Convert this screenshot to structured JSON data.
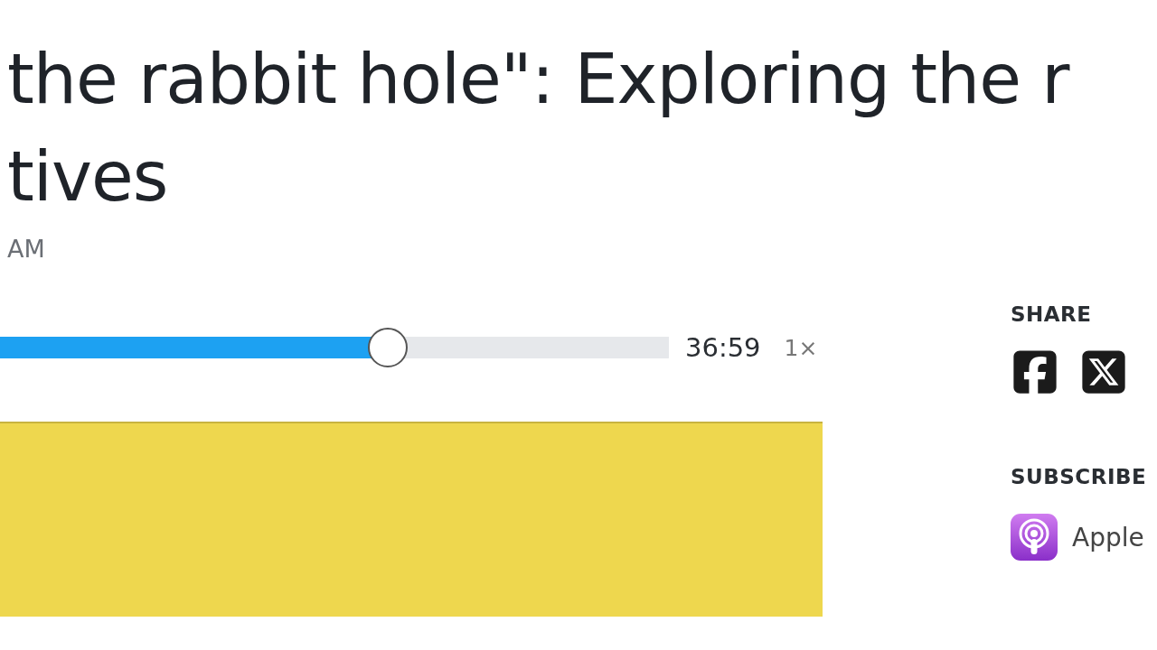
{
  "title_lines": [
    "the rabbit hole\": Exploring the r",
    "tives"
  ],
  "date": "AM",
  "player": {
    "level": 0.58,
    "duration": "36:59",
    "speed": "1×"
  },
  "share": {
    "heading": "SHARE",
    "buttons": [
      {
        "kind": "facebook"
      },
      {
        "kind": "x"
      }
    ]
  },
  "subscribe": {
    "heading": "SUBSCRIBE",
    "links": [
      {
        "kind": "apple",
        "label": "Apple"
      }
    ]
  }
}
